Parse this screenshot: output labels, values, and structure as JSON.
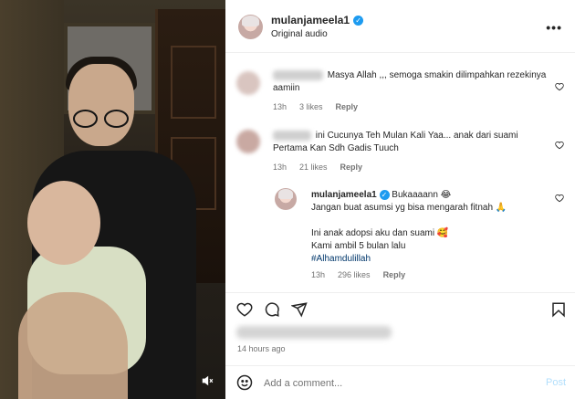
{
  "post": {
    "username": "mulanjameela1",
    "subtitle": "Original audio",
    "more_icon": "more-horizontal-icon"
  },
  "comments": [
    {
      "text": "Masya Allah ,,, semoga smakin dilimpahkan rezekinya aamiin",
      "time": "13h",
      "likes": "3 likes",
      "reply": "Reply"
    },
    {
      "text": "ini Cucunya Teh Mulan Kali Yaa... anak dari suami Pertama Kan Sdh Gadis Tuuch",
      "time": "13h",
      "likes": "21 likes",
      "reply": "Reply"
    }
  ],
  "author_reply": {
    "username": "mulanjameela1",
    "line1": "Bukaaaann 😂",
    "line2": "Jangan buat asumsi yg bisa mengarah fitnah 🙏",
    "line3": "Ini anak adopsi aku dan suami 🥰",
    "line4": "Kami ambil 5 bulan lalu",
    "hashtag": "#Alhamdulillah",
    "time": "13h",
    "likes": "296 likes",
    "reply": "Reply"
  },
  "footer": {
    "timestamp": "14 hours ago",
    "comment_placeholder": "Add a comment...",
    "post_label": "Post"
  },
  "icons": {
    "like": "heart-icon",
    "comment": "comment-icon",
    "share": "share-icon",
    "save": "bookmark-icon",
    "emoji": "emoji-icon",
    "mute": "muted-speaker-icon"
  },
  "colors": {
    "verified": "#1d9bf0",
    "hashtag": "#00376b",
    "post_button": "#b2dffc",
    "muted_text": "#737373"
  }
}
